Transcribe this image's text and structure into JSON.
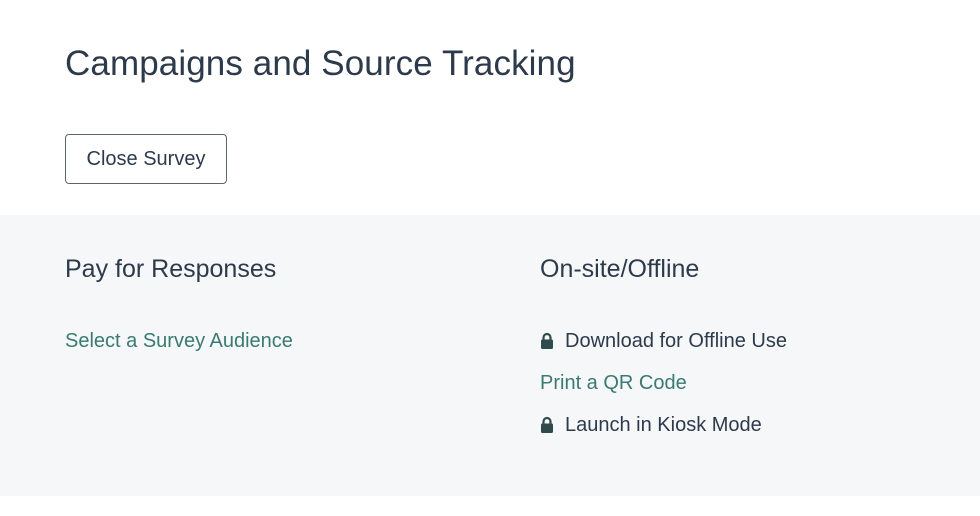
{
  "page": {
    "title": "Campaigns and Source Tracking",
    "close_button_label": "Close Survey"
  },
  "sections": {
    "pay": {
      "heading": "Pay for Responses",
      "items": [
        {
          "label": "Select a Survey Audience",
          "locked": false
        }
      ]
    },
    "offline": {
      "heading": "On-site/Offline",
      "items": [
        {
          "label": "Download for Offline Use",
          "locked": true,
          "icon": "lock-icon"
        },
        {
          "label": "Print a QR Code",
          "locked": false
        },
        {
          "label": "Launch in Kiosk Mode",
          "locked": true,
          "icon": "lock-icon"
        }
      ]
    }
  },
  "colors": {
    "heading_text": "#2d3a4b",
    "link_text": "#3a7a72",
    "options_background": "#f5f7f9",
    "lock_icon": "#2f4a4a"
  }
}
